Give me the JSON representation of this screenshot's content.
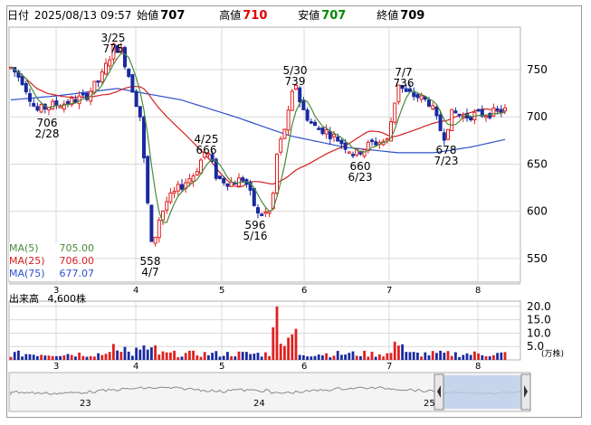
{
  "header": {
    "date_label": "日付",
    "datetime": "2025/08/13 09:57",
    "open_label": "始値",
    "open": "707",
    "high_label": "高値",
    "high": "710",
    "low_label": "安値",
    "low": "707",
    "close_label": "終値",
    "close": "709"
  },
  "ma": [
    {
      "label": "MA(5)",
      "value": "705.00",
      "color": "#4a8a3a"
    },
    {
      "label": "MA(25)",
      "value": "706.00",
      "color": "#d42020"
    },
    {
      "label": "MA(75)",
      "value": "677.07",
      "color": "#3050c8"
    }
  ],
  "volume": {
    "label": "出来高",
    "value": "4,600株",
    "unit": "(万株)",
    "ticks": [
      "20.0",
      "15.0",
      "10.0",
      "5.0"
    ]
  },
  "price_axis": [
    "750",
    "700",
    "650",
    "600",
    "550"
  ],
  "month_labels": [
    "3",
    "4",
    "5",
    "6",
    "7",
    "8"
  ],
  "annotations": [
    {
      "date": "3/25",
      "price": "775"
    },
    {
      "date": "2/28",
      "price": "706"
    },
    {
      "date": "4/25",
      "price": "666"
    },
    {
      "date": "5/30",
      "price": "739"
    },
    {
      "date": "7/7",
      "price": "736"
    },
    {
      "date": "4/7",
      "price": "558"
    },
    {
      "date": "5/16",
      "price": "596"
    },
    {
      "date": "6/23",
      "price": "660"
    },
    {
      "date": "7/23",
      "price": "678"
    }
  ],
  "navigator": {
    "year_labels": [
      "23",
      "24",
      "25"
    ]
  },
  "colors": {
    "up": "#e02020",
    "down": "#1a2aa0",
    "grid": "#d8d8d8"
  }
}
